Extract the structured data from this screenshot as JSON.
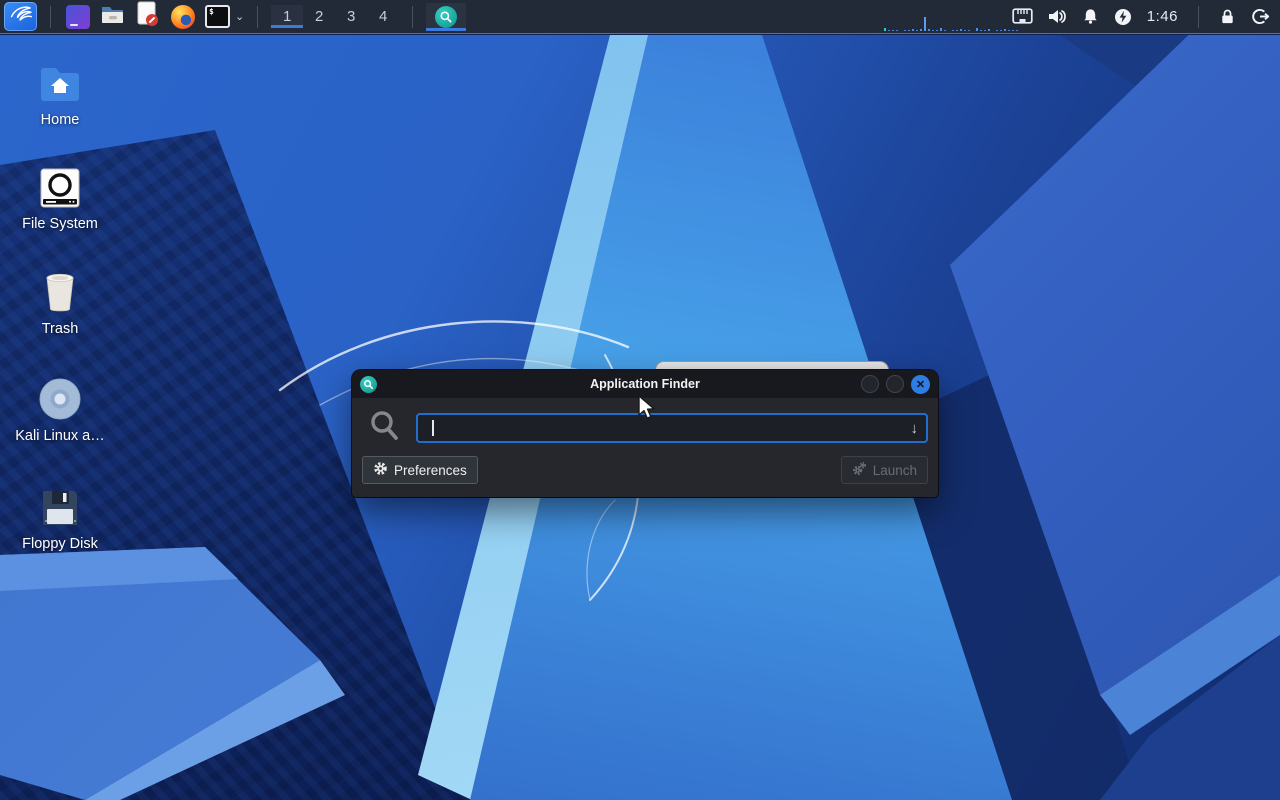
{
  "panel": {
    "launchers": [
      {
        "name": "kali-menu"
      },
      {
        "name": "files-app"
      },
      {
        "name": "file-manager"
      },
      {
        "name": "text-editor"
      },
      {
        "name": "firefox-browser"
      },
      {
        "name": "terminal"
      }
    ],
    "terminal_prompt": "$",
    "workspaces": [
      "1",
      "2",
      "3",
      "4"
    ],
    "active_workspace": "1",
    "window_buttons": [
      {
        "name": "application-finder",
        "icon": "magnifier"
      }
    ],
    "monitor": {
      "bar_color": "#4f92f2",
      "bars": [
        {
          "h": 3,
          "c": "#2bd4c8"
        },
        {
          "h": 1
        },
        {
          "h": 1
        },
        {
          "h": 1
        },
        {
          "h": 0
        },
        {
          "h": 1
        },
        {
          "h": 1
        },
        {
          "h": 2
        },
        {
          "h": 1
        },
        {
          "h": 2
        },
        {
          "h": 14,
          "c": "#5a9cf5"
        },
        {
          "h": 2
        },
        {
          "h": 1
        },
        {
          "h": 1
        },
        {
          "h": 3
        },
        {
          "h": 1
        },
        {
          "h": 0
        },
        {
          "h": 1
        },
        {
          "h": 1
        },
        {
          "h": 2
        },
        {
          "h": 1
        },
        {
          "h": 1
        },
        {
          "h": 0
        },
        {
          "h": 3
        },
        {
          "h": 1
        },
        {
          "h": 1
        },
        {
          "h": 2
        },
        {
          "h": 0
        },
        {
          "h": 1
        },
        {
          "h": 1
        },
        {
          "h": 2
        },
        {
          "h": 1
        },
        {
          "h": 1
        },
        {
          "h": 1
        }
      ]
    },
    "tray_icons": [
      "network",
      "volume",
      "notifications",
      "power-manager"
    ],
    "clock": "1:46",
    "session_icons": [
      "lock-screen",
      "logout"
    ]
  },
  "desktop": {
    "icons": [
      {
        "label": "Home"
      },
      {
        "label": "File System"
      },
      {
        "label": "Trash"
      },
      {
        "label": "Kali Linux a…"
      },
      {
        "label": "Floppy Disk"
      }
    ]
  },
  "finder": {
    "title": "Application Finder",
    "search_value": "",
    "search_placeholder": "",
    "combo_arrow": "↓",
    "preferences_label": "Preferences",
    "launch_label": "Launch"
  },
  "colors": {
    "panel_bg": "#232a37",
    "panel_underline": "#3a7bdd",
    "accent_blue": "#1f6fd0",
    "dialog_bg": "#25272c",
    "titlebar_bg": "#17191e",
    "close_button": "#2e7de4",
    "finder_teal": "#1fa89e",
    "wallpaper_bright": "#47a0e8",
    "wallpaper_dark": "#0b1c50"
  }
}
